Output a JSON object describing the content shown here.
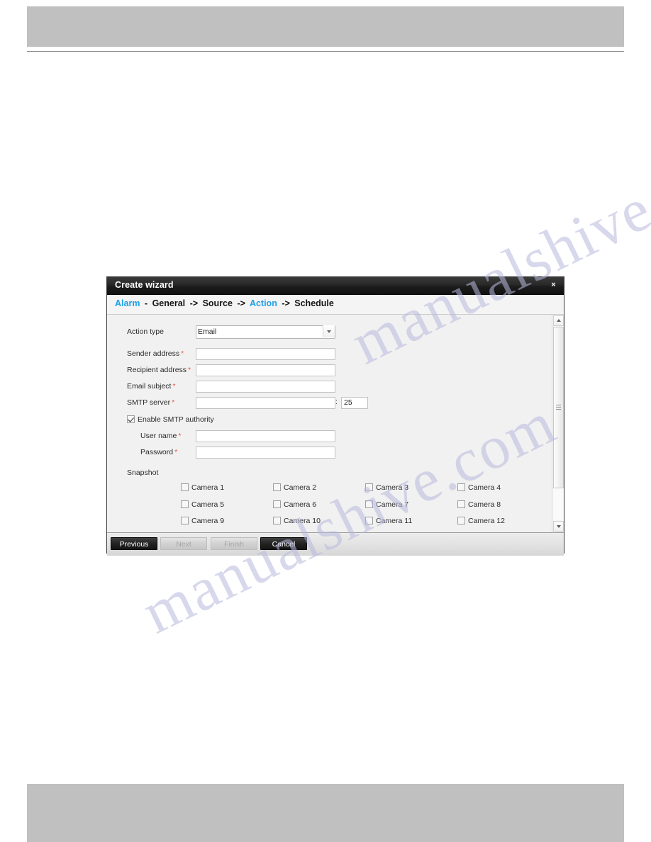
{
  "page": {
    "header_band": "",
    "footer_band": "",
    "watermark_line1": "manualshive.com",
    "watermark_line2": "manualshive.com"
  },
  "dialog": {
    "title": "Create wizard",
    "close_label": "×",
    "breadcrumb": [
      {
        "label": "Alarm",
        "active": true
      },
      {
        "label": "General",
        "active": false
      },
      {
        "label": "Source",
        "active": false
      },
      {
        "label": "Action",
        "active": true
      },
      {
        "label": "Schedule",
        "active": false
      }
    ],
    "breadcrumb_separator": "->",
    "breadcrumb_first_separator": "-",
    "accent_color": "#1fa0e8",
    "required_marker": "*",
    "required_color": "#e8564c",
    "form": {
      "action_type": {
        "label": "Action type",
        "value": "Email",
        "options": [
          "Email"
        ]
      },
      "sender_address": {
        "label": "Sender address",
        "required": true,
        "value": "",
        "placeholder": ""
      },
      "recipient_address": {
        "label": "Recipient address",
        "required": true,
        "value": "",
        "placeholder": ""
      },
      "email_subject": {
        "label": "Email subject",
        "required": true,
        "value": "",
        "placeholder": ""
      },
      "smtp_server": {
        "label": "SMTP server",
        "required": true,
        "value": "",
        "placeholder": "",
        "port_separator": ":",
        "port_value": "25"
      },
      "enable_smtp_authority": {
        "label": "Enable SMTP authority",
        "checked": true
      },
      "user_name": {
        "label": "User name",
        "required": true,
        "value": "",
        "placeholder": ""
      },
      "password": {
        "label": "Password",
        "required": true,
        "value": "",
        "placeholder": ""
      },
      "snapshot": {
        "label": "Snapshot",
        "cameras": [
          {
            "label": "Camera 1",
            "checked": false
          },
          {
            "label": "Camera 2",
            "checked": false
          },
          {
            "label": "Camera 3",
            "checked": false
          },
          {
            "label": "Camera 4",
            "checked": false
          },
          {
            "label": "Camera 5",
            "checked": false
          },
          {
            "label": "Camera 6",
            "checked": false
          },
          {
            "label": "Camera 7",
            "checked": false
          },
          {
            "label": "Camera 8",
            "checked": false
          },
          {
            "label": "Camera 9",
            "checked": false
          },
          {
            "label": "Camera 10",
            "checked": false
          },
          {
            "label": "Camera 11",
            "checked": false
          },
          {
            "label": "Camera 12",
            "checked": false
          }
        ]
      }
    },
    "buttons": {
      "previous": {
        "label": "Previous",
        "disabled": false
      },
      "next": {
        "label": "Next",
        "disabled": true
      },
      "finish": {
        "label": "Finish",
        "disabled": true
      },
      "cancel": {
        "label": "Cancel",
        "disabled": false
      }
    }
  }
}
